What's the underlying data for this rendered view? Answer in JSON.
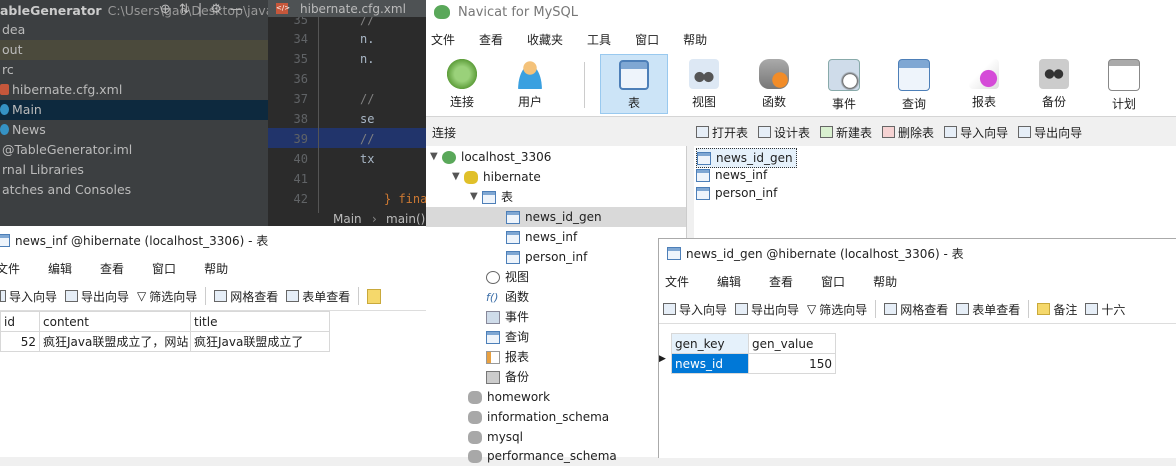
{
  "ide": {
    "project_title": "ableGenerator",
    "project_path": "C:\\Users\\gao\\Desktop\\javaee",
    "tree": [
      "dea",
      "out",
      "rc",
      "hibernate.cfg.xml",
      "Main",
      "News",
      "@TableGenerator.iml",
      "rnal Libraries",
      "atches and Consoles"
    ],
    "editor_tab": "hibernate.cfg.xml",
    "line_numbers": [
      "35",
      "34",
      "35",
      "36",
      "37",
      "38",
      "39",
      "40",
      "41",
      "42"
    ],
    "code_lines": [
      "//",
      "n.",
      "n.",
      "",
      "//",
      "se",
      "//",
      "tx",
      "",
      "} fina"
    ],
    "breadcrumb_main": "Main",
    "breadcrumb_method": "main()"
  },
  "navicat": {
    "title": "Navicat for MySQL",
    "menu": [
      "文件",
      "查看",
      "收藏夹",
      "工具",
      "窗口",
      "帮助"
    ],
    "toolbar": [
      "连接",
      "用户",
      "表",
      "视图",
      "函数",
      "事件",
      "查询",
      "报表",
      "备份",
      "计划"
    ],
    "connection_label": "连接",
    "object_bar": [
      "打开表",
      "设计表",
      "新建表",
      "删除表",
      "导入向导",
      "导出向导"
    ],
    "tree": {
      "connection": "localhost_3306",
      "database": "hibernate",
      "tables_group": "表",
      "tables": [
        "news_id_gen",
        "news_inf",
        "person_inf"
      ],
      "other_groups": [
        "视图",
        "函数",
        "事件",
        "查询",
        "报表",
        "备份"
      ],
      "other_dbs": [
        "homework",
        "information_schema",
        "mysql",
        "performance_schema"
      ]
    },
    "objects": [
      "news_id_gen",
      "news_inf",
      "person_inf"
    ]
  },
  "news_window": {
    "title": "news_inf @hibernate (localhost_3306) - 表",
    "menu": [
      "文件",
      "编辑",
      "查看",
      "窗口",
      "帮助"
    ],
    "tools": [
      "导入向导",
      "导出向导",
      "筛选向导",
      "网格查看",
      "表单查看"
    ],
    "columns": [
      "id",
      "content",
      "title"
    ],
    "rows": [
      [
        "52",
        "疯狂Java联盟成立了，网站",
        "疯狂Java联盟成立了"
      ]
    ]
  },
  "gen_window": {
    "title": "news_id_gen @hibernate (localhost_3306) - 表",
    "menu": [
      "文件",
      "编辑",
      "查看",
      "窗口",
      "帮助"
    ],
    "tools": [
      "导入向导",
      "导出向导",
      "筛选向导",
      "网格查看",
      "表单查看",
      "备注",
      "十六"
    ],
    "columns": [
      "gen_key",
      "gen_value"
    ],
    "rows": [
      [
        "news_id",
        "150"
      ]
    ]
  }
}
